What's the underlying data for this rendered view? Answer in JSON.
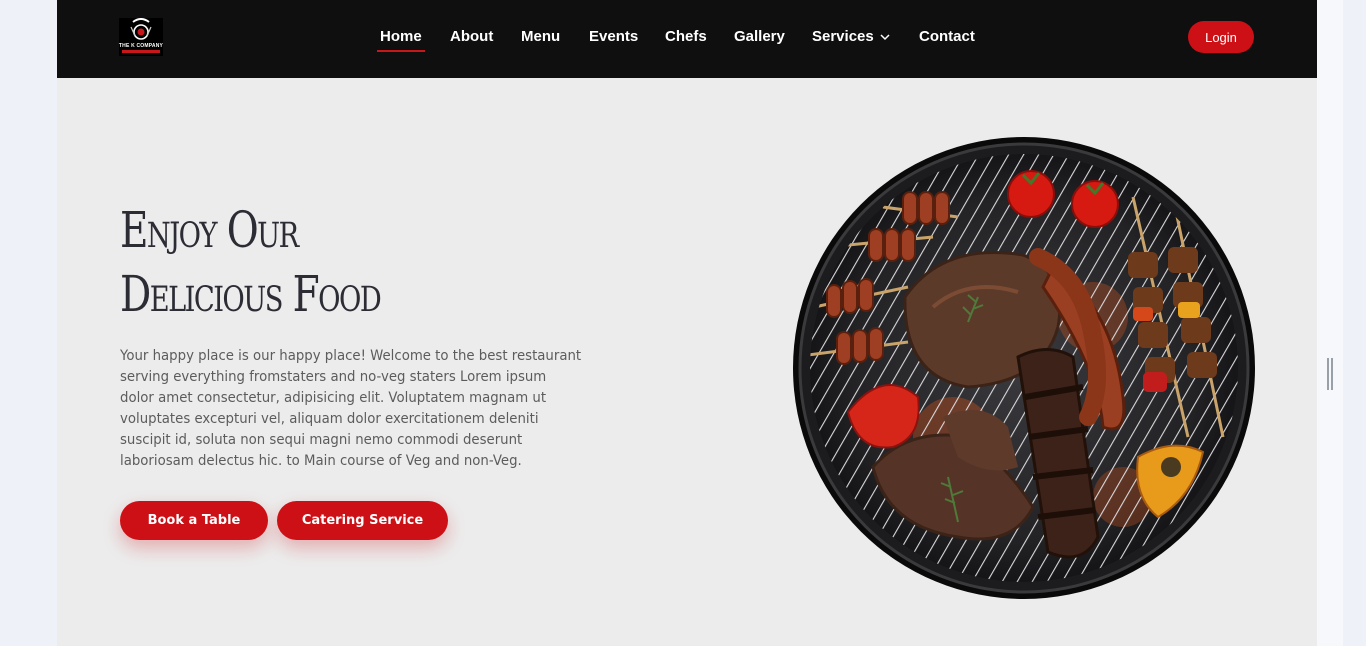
{
  "brand": {
    "logo_text": "THE K COMPANY",
    "accent_color": "#cc1016"
  },
  "nav": {
    "items": [
      {
        "label": "Home",
        "active": true
      },
      {
        "label": "About"
      },
      {
        "label": "Menu"
      },
      {
        "label": "Events"
      },
      {
        "label": "Chefs"
      },
      {
        "label": "Gallery"
      },
      {
        "label": "Services",
        "has_dropdown": true
      },
      {
        "label": "Contact"
      }
    ],
    "login_label": "Login"
  },
  "hero": {
    "title_line1": "Enjoy Our",
    "title_line2": "Delicious Food",
    "description": "Your happy place is our happy place! Welcome to the best restaurant serving everything fromstaters and no-veg staters Lorem ipsum dolor amet consectetur, adipisicing elit. Voluptatem magnam ut voluptates excepturi vel, aliquam dolor exercitationem deleniti suscipit id, soluta non sequi magni nemo commodi deserunt laboriosam delectus hic. to Main course of Veg and non-Veg.",
    "book_label": "Book a Table",
    "catering_label": "Catering Service",
    "image": "bbq-grill-with-meats-and-vegetables"
  },
  "icons": {
    "dropdown": "chevron-down-icon",
    "scroll_handle": "drag-handle-icon"
  }
}
